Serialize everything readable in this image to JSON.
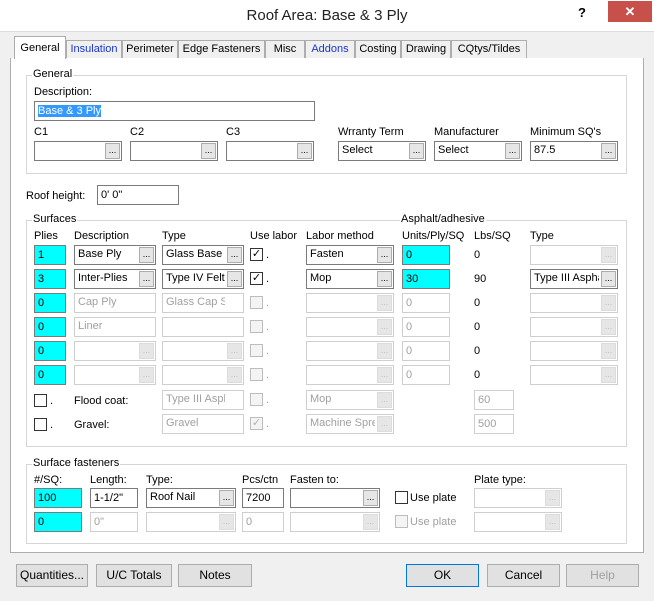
{
  "window": {
    "title": "Roof Area: Base & 3 Ply",
    "help_glyph": "?",
    "close_glyph": "✕"
  },
  "tabs": [
    "General",
    "Insulation",
    "Perimeter",
    "Edge Fasteners",
    "Misc",
    "Addons",
    "Costing",
    "Drawing",
    "CQtys/Tildes"
  ],
  "general": {
    "group_label": "General",
    "description_label": "Description:",
    "description_value": "Base & 3 Ply",
    "c1_label": "C1",
    "c2_label": "C2",
    "c3_label": "C3",
    "c1_value": "",
    "c2_value": "",
    "c3_value": "",
    "warranty_label": "Wrranty Term",
    "warranty_value": "Select",
    "manufacturer_label": "Manufacturer",
    "manufacturer_value": "Select",
    "min_sq_label": "Minimum SQ's",
    "min_sq_value": "87.5"
  },
  "roof_height": {
    "label": "Roof height:",
    "value": "0' 0\""
  },
  "surfaces": {
    "group_label": "Surfaces",
    "asphalt_label": "Asphalt/adhesive",
    "headers": {
      "plies": "Plies",
      "description": "Description",
      "type": "Type",
      "use_labor": "Use labor",
      "labor_method": "Labor method",
      "units": "Units/Ply/SQ",
      "lbs": "Lbs/SQ",
      "atype": "Type"
    },
    "rows": [
      {
        "plies": "1",
        "description": "Base Ply",
        "type": "Glass Base S",
        "labor_method": "Fasten",
        "units": "0",
        "lbs": "0",
        "atype": ""
      },
      {
        "plies": "3",
        "description": "Inter-Plies",
        "type": "Type IV Felt",
        "labor_method": "Mop",
        "units": "30",
        "lbs": "90",
        "atype": "Type III Aspha"
      },
      {
        "plies": "0",
        "description": "Cap Ply",
        "type": "Glass Cap SI",
        "labor_method": "",
        "units": "0",
        "lbs": "0",
        "atype": ""
      },
      {
        "plies": "0",
        "description": "Liner",
        "type": "",
        "labor_method": "",
        "units": "0",
        "lbs": "0",
        "atype": ""
      },
      {
        "plies": "0",
        "description": "",
        "type": "",
        "labor_method": "",
        "units": "0",
        "lbs": "0",
        "atype": ""
      },
      {
        "plies": "0",
        "description": "",
        "type": "",
        "labor_method": "",
        "units": "0",
        "lbs": "0",
        "atype": ""
      }
    ],
    "flood": {
      "label": "Flood coat:",
      "type": "Type III Asph",
      "labor_method": "Mop",
      "lbs": "60"
    },
    "gravel": {
      "label": "Gravel:",
      "type": "Gravel",
      "labor_method": "Machine Sprea",
      "lbs": "500"
    },
    "check_glyph": "✓",
    "dot": "."
  },
  "fasteners": {
    "group_label": "Surface fasteners",
    "headers": {
      "per_sq": "#/SQ:",
      "length": "Length:",
      "type": "Type:",
      "pcs": "Pcs/ctn",
      "fasten_to": "Fasten to:",
      "plate_type": "Plate type:"
    },
    "use_plate_label": "Use plate",
    "rows": [
      {
        "per_sq": "100",
        "length": "1-1/2\"",
        "type": "Roof Nail",
        "pcs": "7200",
        "fasten_to": "",
        "plate_type": ""
      },
      {
        "per_sq": "0",
        "length": "0\"",
        "type": "",
        "pcs": "0",
        "fasten_to": "",
        "plate_type": ""
      }
    ]
  },
  "buttons": {
    "quantities": "Quantities...",
    "uc_totals": "U/C Totals",
    "notes": "Notes",
    "ok": "OK",
    "cancel": "Cancel",
    "help": "Help",
    "ellipsis": "..."
  },
  "colors": {
    "highlight_cyan": "#00ffff",
    "selection": "#3399ff",
    "close": "#c7504a",
    "tab_blue": "#1a36c8"
  }
}
